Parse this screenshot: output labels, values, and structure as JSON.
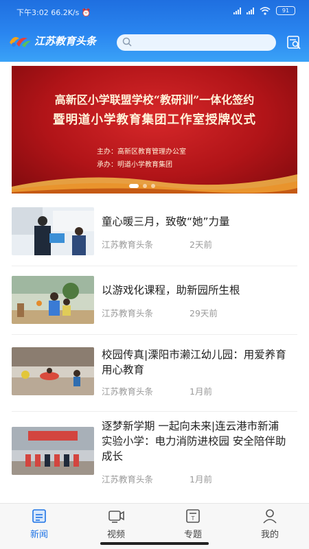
{
  "status": {
    "time": "下午3:02",
    "speed": "66.2K/s",
    "battery": "91"
  },
  "header": {
    "app_name": "江苏教育头条",
    "search_placeholder": ""
  },
  "banner": {
    "line1": "高新区小学联盟学校“教研训”一体化签约",
    "line2": "暨明道小学教育集团工作室授牌仪式",
    "org1": "主办：高新区教育管理办公室",
    "org2": "承办：明道小学教育集团",
    "slide_count": 3,
    "active_slide": 1
  },
  "news": [
    {
      "title": "童心暖三月，致敬“她”力量",
      "source": "江苏教育头条",
      "time": "2天前"
    },
    {
      "title": "以游戏化课程，助新园所生根",
      "source": "江苏教育头条",
      "time": "29天前"
    },
    {
      "title": "校园传真|溧阳市濑江幼儿园：用爱养育 用心教育",
      "source": "江苏教育头条",
      "time": "1月前"
    },
    {
      "title": "逐梦新学期 一起向未来|连云港市新浦实验小学：电力消防进校园 安全陪伴助成长",
      "source": "江苏教育头条",
      "time": "1月前"
    }
  ],
  "nav": [
    {
      "label": "新闻",
      "icon": "news-icon",
      "active": true
    },
    {
      "label": "视频",
      "icon": "video-icon",
      "active": false
    },
    {
      "label": "专题",
      "icon": "topic-icon",
      "active": false
    },
    {
      "label": "我的",
      "icon": "profile-icon",
      "active": false
    }
  ],
  "colors": {
    "header": "#2a86f0",
    "accent": "#1f74e6",
    "banner": "#b11418"
  }
}
